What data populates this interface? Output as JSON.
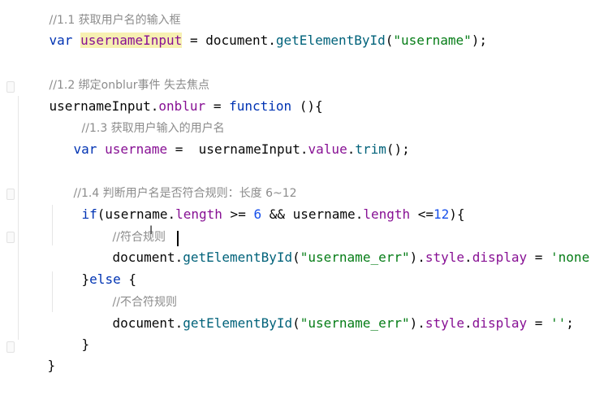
{
  "lines": {
    "l0": "//1.1 获取用户名的输入框",
    "l1_kw": "var",
    "l1_var": "usernameInput",
    "l1_eq": " = document.",
    "l1_fn": "getElementById",
    "l1_str": "(\"username\");",
    "l3": "//1.2 绑定onblur事件 失去焦点",
    "l4_a": "usernameInput.",
    "l4_b": "onblur",
    "l4_c": " = ",
    "l4_kw": "function",
    "l4_d": " (){",
    "l5": "//1.3 获取用户输入的用户名",
    "l6_kw": "var",
    "l6_var": "username",
    "l6_eq": " =  usernameInput.",
    "l6_prop": "value",
    "l6_dot": ".",
    "l6_fn": "trim",
    "l6_end": "();",
    "l8": "//1.4 判断用户名是否符合规则：长度 6~12",
    "l9_kw": "if",
    "l9_a": "(username.",
    "l9_p1": "length",
    "l9_b": " >= ",
    "l9_n1": "6",
    "l9_c": " && username.",
    "l9_p2": "length",
    "l9_d": " <=",
    "l9_n2": "12",
    "l9_e": "){",
    "l10": "//符合规则",
    "l11_a": "document.",
    "l11_fn1": "get",
    "l11_fn2": "ElementById",
    "l11_b": "(",
    "l11_str": "\"username_err\"",
    "l11_c": ").",
    "l11_p1": "style",
    "l11_dot": ".",
    "l11_p2": "display",
    "l11_d": " = ",
    "l11_str2": "'none'",
    "l11_e": ";",
    "l12_a": "}",
    "l12_kw": "else",
    "l12_b": " {",
    "l13": "//不合符规则",
    "l14_a": "document.",
    "l14_fn": "getElementById",
    "l14_b": "(",
    "l14_str": "\"username_err\"",
    "l14_c": ").",
    "l14_p1": "style",
    "l14_dot": ".",
    "l14_p2": "display",
    "l14_d": " = ",
    "l14_str2": "''",
    "l14_e": ";",
    "l15": "}",
    "l16": "}"
  },
  "colors": {
    "keyword": "#0033b3",
    "variable": "#871094",
    "function": "#00627a",
    "string": "#067d17",
    "number": "#1750eb",
    "comment": "#8c8c8c",
    "highlight": "#f7f0b2"
  }
}
